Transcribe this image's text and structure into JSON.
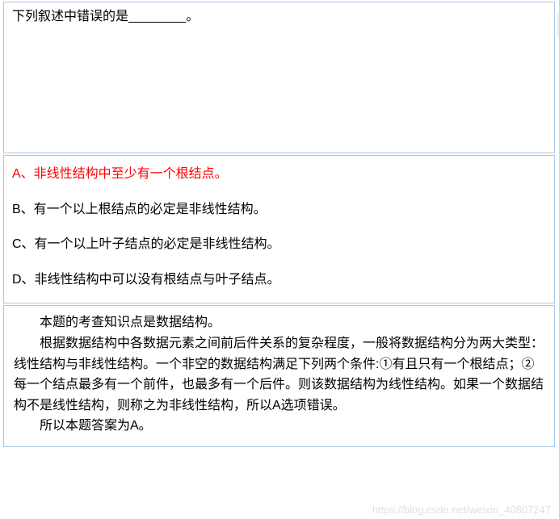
{
  "question": {
    "stem_prefix": "下列叙述中错误的是",
    "blank": "________",
    "stem_suffix": "。"
  },
  "options": {
    "a": "A、非线性结构中至少有一个根结点。",
    "b": "B、有一个以上根结点的必定是非线性结构。",
    "c": "C、有一个以上叶子结点的必定是非线性结构。",
    "d": "D、非线性结构中可以没有根结点与叶子结点。"
  },
  "explanation": {
    "line1": "本题的考查知识点是数据结构。",
    "body": "根据数据结构中各数据元素之间前后件关系的复杂程度，一般将数据结构分为两大类型：线性结构与非线性结构。一个非空的数据结构满足下列两个条件:①有且只有一个根结点；②每一个结点最多有一个前件，也最多有一个后件。则该数据结构为线性结构。如果一个数据结构不是线性结构，则称之为非线性结构，所以A选项错误。",
    "conclusion": "所以本题答案为A。"
  },
  "watermark": "https://blog.csdn.net/weixin_40807247"
}
